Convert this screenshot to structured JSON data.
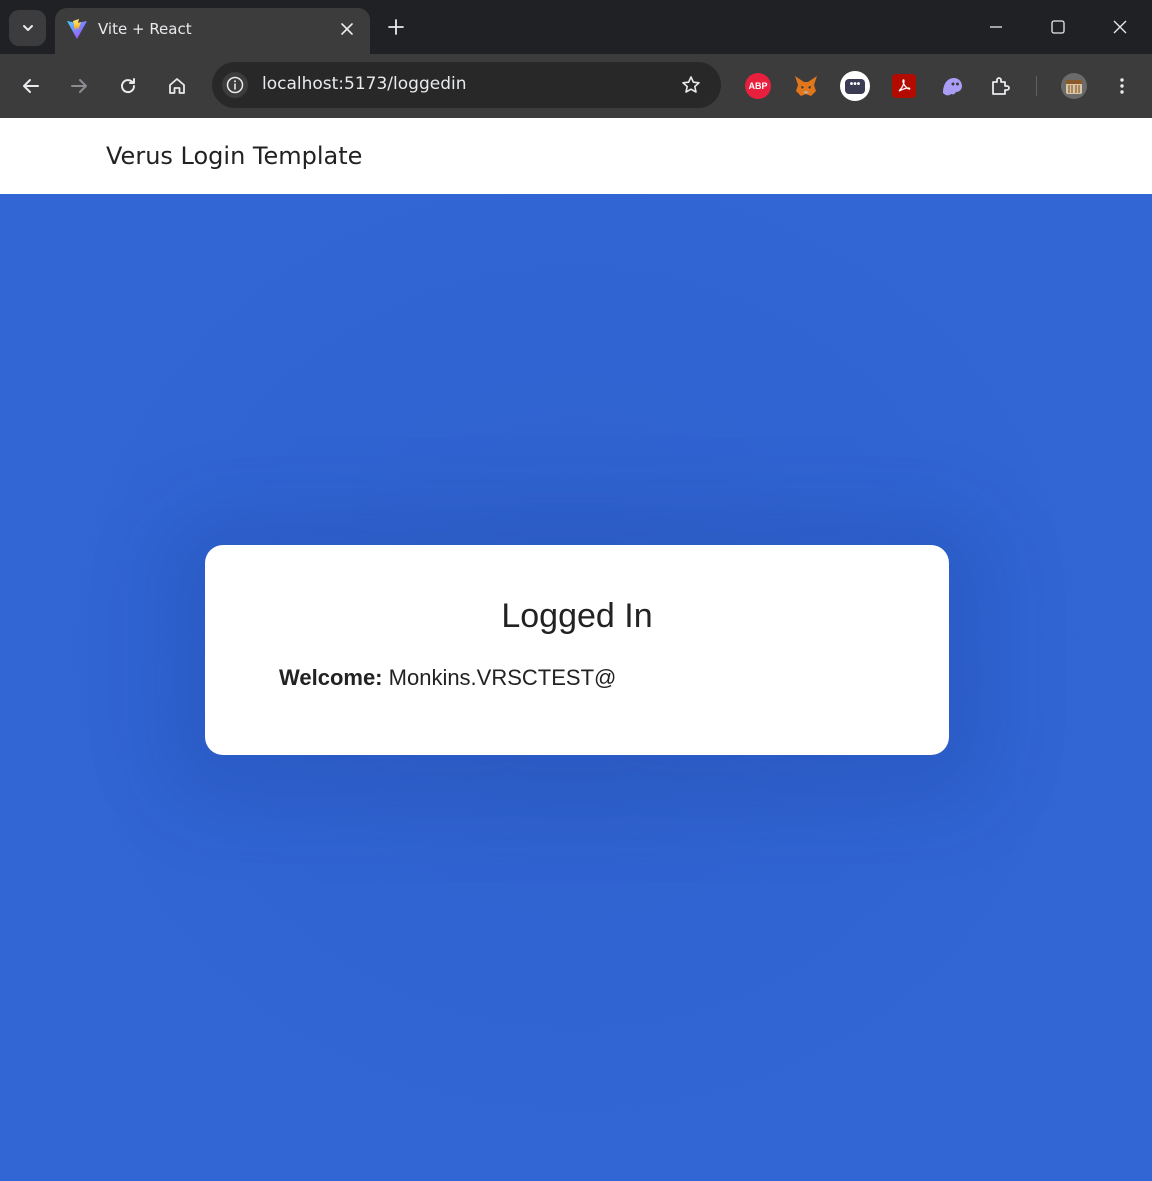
{
  "browser": {
    "tab": {
      "title": "Vite + React"
    },
    "address_bar": {
      "url": "localhost:5173/loggedin"
    },
    "extensions": [
      {
        "name": "adblock-plus",
        "label": "ABP"
      },
      {
        "name": "metamask"
      },
      {
        "name": "password-manager"
      },
      {
        "name": "adobe-acrobat"
      },
      {
        "name": "ghost"
      },
      {
        "name": "extensions-puzzle"
      }
    ]
  },
  "header": {
    "brand": "Verus Login Template"
  },
  "card": {
    "title": "Logged In",
    "welcome_label": "Welcome:",
    "welcome_value": "Monkins.VRSCTEST@"
  },
  "colors": {
    "page_background": "#3166d4",
    "card_background": "#ffffff",
    "header_background": "#ffffff",
    "text": "#222222"
  }
}
